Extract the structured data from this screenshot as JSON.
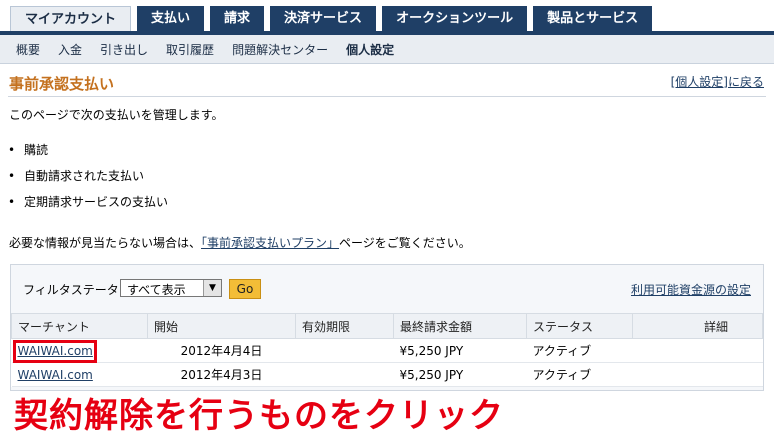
{
  "tabs": [
    {
      "label": "マイアカウント",
      "active": true
    },
    {
      "label": "支払い"
    },
    {
      "label": "請求"
    },
    {
      "label": "決済サービス"
    },
    {
      "label": "オークションツール"
    },
    {
      "label": "製品とサービス"
    }
  ],
  "subnav": [
    "概要",
    "入金",
    "引き出し",
    "取引履歴",
    "問題解決センター",
    "個人設定"
  ],
  "page": {
    "title": "事前承認支払い",
    "back_link": "[個人設定]に戻る",
    "intro": "このページで次の支払いを管理します。",
    "bullets": [
      "購読",
      "自動請求された支払い",
      "定期請求サービスの支払い"
    ],
    "help_prefix": "必要な情報が見当たらない場合は、",
    "help_link": "「事前承認支払いプラン」",
    "help_suffix": "ページをご覧ください。"
  },
  "filter": {
    "label": "フィルタステータス:",
    "selected": "すべて表示",
    "go_label": "Go",
    "funding_link": "利用可能資金源の設定"
  },
  "table": {
    "headers": [
      "マーチャント",
      "開始",
      "有効期限",
      "最終請求金額",
      "ステータス",
      "詳細"
    ],
    "rows": [
      {
        "merchant": "WAIWAI.com",
        "start": "2012年4月4日",
        "expiry": "",
        "amount": "¥5,250 JPY",
        "status": "アクティブ",
        "detail": ""
      },
      {
        "merchant": "WAIWAI.com",
        "start": "2012年4月3日",
        "expiry": "",
        "amount": "¥5,250 JPY",
        "status": "アクティブ",
        "detail": ""
      }
    ]
  },
  "annotation": "契約解除を行うものをクリック",
  "colors": {
    "nav": "#1f3f66",
    "title": "#c4711f",
    "annotation": "#e60012",
    "go_button": "#f3bd37"
  }
}
